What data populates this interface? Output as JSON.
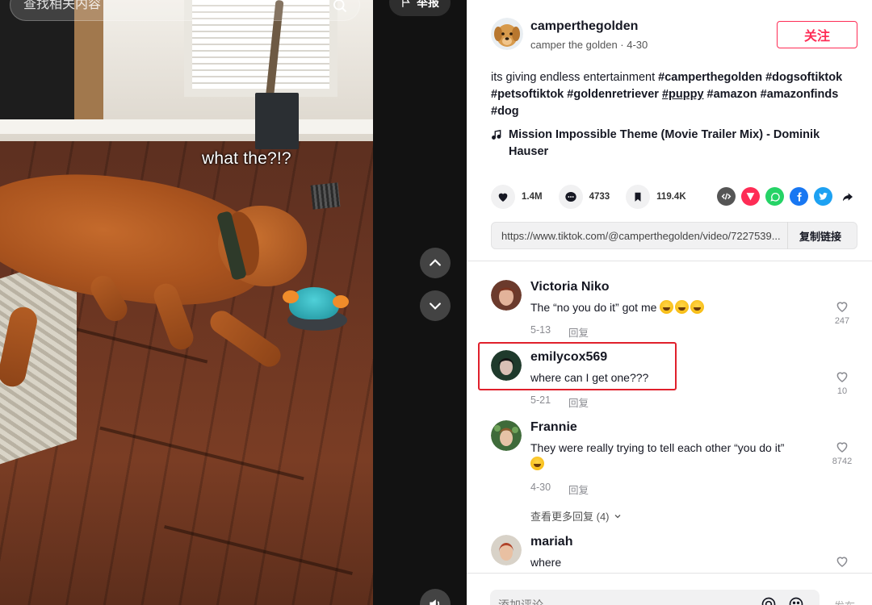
{
  "video": {
    "search_placeholder": "查找相关内容",
    "report_label": "举报",
    "caption": "what the?!?"
  },
  "post": {
    "username": "camperthegolden",
    "subtitle": "camper the golden · 4-30",
    "follow_label": "关注",
    "description_prefix": "its giving endless entertainment ",
    "hashtags": [
      "#camperthegolden",
      "#dogsoftiktok",
      "#petsoftiktok",
      "#goldenretriever",
      "#puppy",
      "#amazon",
      "#amazonfinds",
      "#dog"
    ],
    "music": "Mission Impossible Theme (Movie Trailer Mix) - Dominik Hauser",
    "likes": "1.4M",
    "comments": "4733",
    "saves": "119.4K",
    "link": "https://www.tiktok.com/@camperthegolden/video/7227539...",
    "copy_label": "复制链接"
  },
  "share_icons": [
    {
      "name": "embed-icon",
      "color": "#555555"
    },
    {
      "name": "send-icon",
      "color": "#fe2c55"
    },
    {
      "name": "whatsapp-icon",
      "color": "#25d366"
    },
    {
      "name": "facebook-icon",
      "color": "#1877f2"
    },
    {
      "name": "twitter-icon",
      "color": "#1da1f2"
    },
    {
      "name": "share-arrow-icon",
      "color": "#161823"
    }
  ],
  "comments": [
    {
      "user": "Victoria Niko",
      "text": "The “no you do it” got me",
      "emoji_count": 3,
      "date": "5-13",
      "reply": "回复",
      "likes": "247"
    },
    {
      "user": "emilycox569",
      "text": "where can I get one???",
      "emoji_count": 0,
      "date": "5-21",
      "reply": "回复",
      "likes": "10"
    },
    {
      "user": "Frannie",
      "text": "They were really trying to tell each other “you do it”",
      "emoji_count": 1,
      "date": "4-30",
      "reply": "回复",
      "likes": "8742"
    },
    {
      "user": "mariah",
      "text": "where",
      "emoji_count": 0,
      "date": "",
      "reply": "",
      "likes": ""
    }
  ],
  "more_replies": "查看更多回复 (4)",
  "comment_bar": {
    "placeholder": "添加评论...",
    "post_label": "发布"
  },
  "colors": {
    "accent": "#fe2c55",
    "highlight": "#e0202c"
  }
}
